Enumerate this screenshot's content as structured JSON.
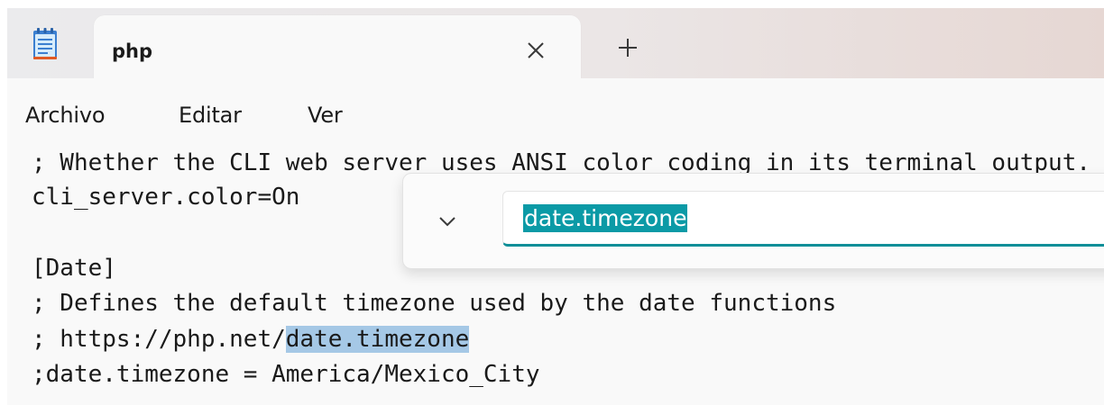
{
  "tab": {
    "title": "php"
  },
  "menu": {
    "file": "Archivo",
    "edit": "Editar",
    "view": "Ver"
  },
  "editor": {
    "line1": "; Whether the CLI web server uses ANSI color coding in its terminal output.",
    "line2": "cli_server.color=On",
    "line4": "[Date]",
    "line5": "; Defines the default timezone used by the date functions",
    "line6_prefix": "; https://php.net/",
    "line6_selected": "date.timezone",
    "line7": ";date.timezone = America/Mexico_City"
  },
  "find": {
    "query": "date.timezone"
  },
  "colors": {
    "accent": "#0b9aa6",
    "selection": "#a5c8e6"
  },
  "icons": {
    "app": "notepad-icon",
    "close": "close-icon",
    "add": "plus-icon",
    "toggle": "chevron-down-icon"
  }
}
